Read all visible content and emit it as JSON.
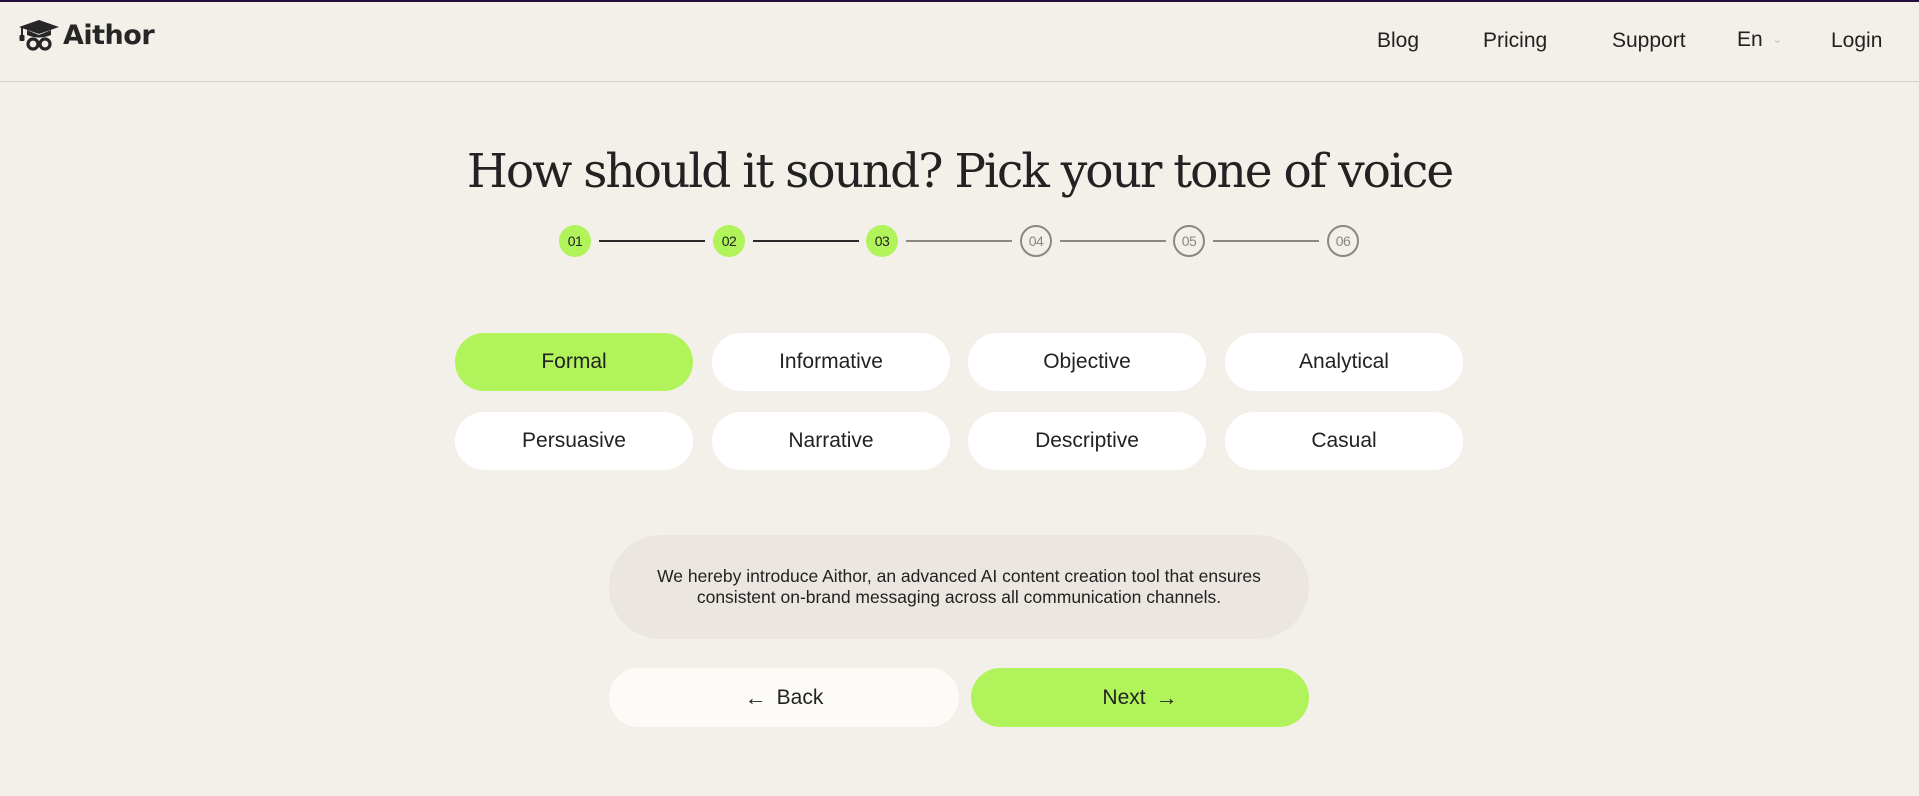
{
  "header": {
    "logo_text": "Aithor",
    "nav": [
      {
        "label": "Blog"
      },
      {
        "label": "Pricing"
      },
      {
        "label": "Support"
      },
      {
        "label": "Login"
      }
    ],
    "language": {
      "selected": "En",
      "icon": "chevron-down-icon"
    }
  },
  "title": "How should it sound? Pick your tone of voice",
  "stepper": {
    "current_step": 3,
    "total_steps": 6,
    "steps": [
      {
        "label": "01",
        "status": "done"
      },
      {
        "label": "02",
        "status": "done"
      },
      {
        "label": "03",
        "status": "done"
      },
      {
        "label": "04",
        "status": "todo"
      },
      {
        "label": "05",
        "status": "todo"
      },
      {
        "label": "06",
        "status": "todo"
      }
    ]
  },
  "tones": {
    "selected": "Formal",
    "options": [
      {
        "label": "Formal"
      },
      {
        "label": "Informative"
      },
      {
        "label": "Objective"
      },
      {
        "label": "Analytical"
      },
      {
        "label": "Persuasive"
      },
      {
        "label": "Narrative"
      },
      {
        "label": "Descriptive"
      },
      {
        "label": "Casual"
      }
    ]
  },
  "preview_text": "We hereby introduce Aithor, an advanced AI content creation tool that ensures consistent on-brand messaging across all communication channels.",
  "actions": {
    "back_label": "Back",
    "back_icon": "arrow-left-icon",
    "next_label": "Next",
    "next_icon": "arrow-right-icon"
  },
  "colors": {
    "accent": "#b1f35a",
    "background": "#f3efe9",
    "top_bar": "#24103f",
    "text": "#222222"
  }
}
